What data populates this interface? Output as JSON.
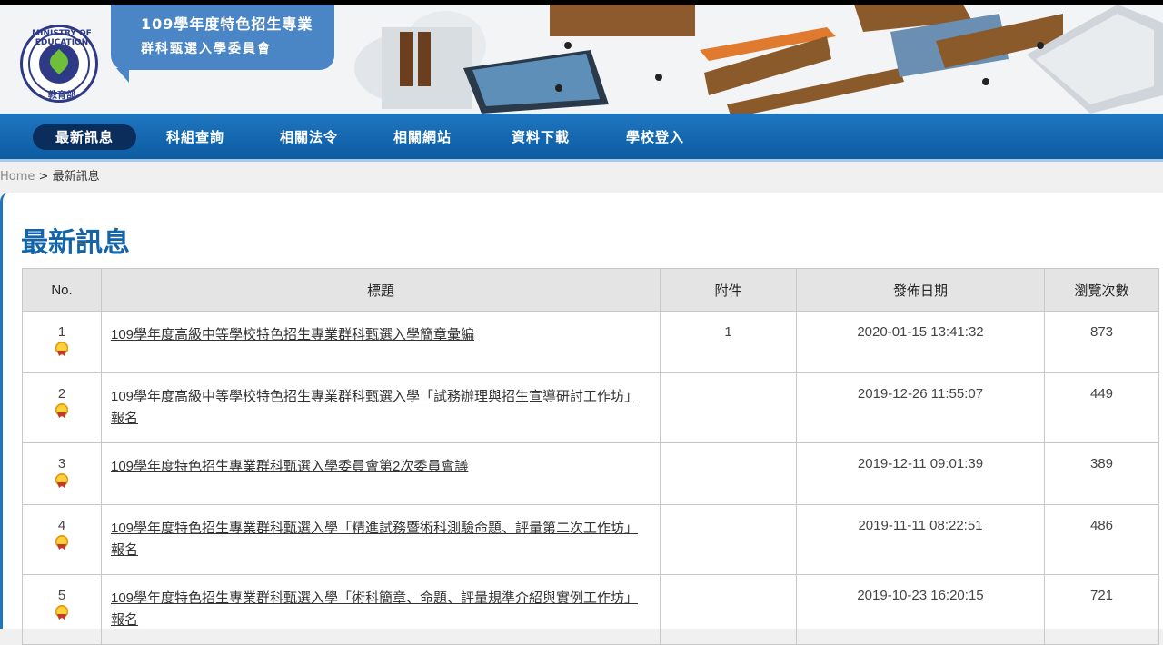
{
  "header": {
    "logo_top_text": "MINISTRY OF EDUCATION",
    "logo_bottom_text": "教育部",
    "bubble_line1": "109學年度特色招生專業",
    "bubble_line2": "群科甄選入學委員會"
  },
  "nav": {
    "items": [
      {
        "label": "最新訊息",
        "active": true
      },
      {
        "label": "科組查詢"
      },
      {
        "label": "相關法令"
      },
      {
        "label": "相關網站"
      },
      {
        "label": "資料下載"
      },
      {
        "label": "學校登入"
      }
    ]
  },
  "breadcrumb": {
    "home": "Home",
    "separator": " > ",
    "current": "最新訊息"
  },
  "page": {
    "title": "最新訊息"
  },
  "table": {
    "headers": [
      "No.",
      "標題",
      "附件",
      "發佈日期",
      "瀏覽次數"
    ],
    "rows": [
      {
        "no": "1",
        "title": "109學年度高級中等學校特色招生專業群科甄選入學簡章彙編",
        "attachment": "1",
        "date": "2020-01-15 13:41:32",
        "views": "873"
      },
      {
        "no": "2",
        "title": "109學年度高級中等學校特色招生專業群科甄選入學「試務辦理與招生宣導研討工作坊」報名",
        "attachment": "",
        "date": "2019-12-26 11:55:07",
        "views": "449"
      },
      {
        "no": "3",
        "title": "109學年度特色招生專業群科甄選入學委員會第2次委員會議",
        "attachment": "",
        "date": "2019-12-11 09:01:39",
        "views": "389"
      },
      {
        "no": "4",
        "title": "109學年度特色招生專業群科甄選入學「精進試務暨術科測驗命題、評量第二次工作坊」報名",
        "attachment": "",
        "date": "2019-11-11 08:22:51",
        "views": "486"
      },
      {
        "no": "5",
        "title": "109學年度特色招生專業群科甄選入學「術科簡章、命題、評量規準介紹與實例工作坊」報名",
        "attachment": "",
        "date": "2019-10-23 16:20:15",
        "views": "721"
      }
    ]
  },
  "colors": {
    "nav_blue": "#1f76c0",
    "nav_active": "#0b2d5c",
    "title_blue": "#1464a8",
    "bubble_blue": "#4a86c5"
  }
}
